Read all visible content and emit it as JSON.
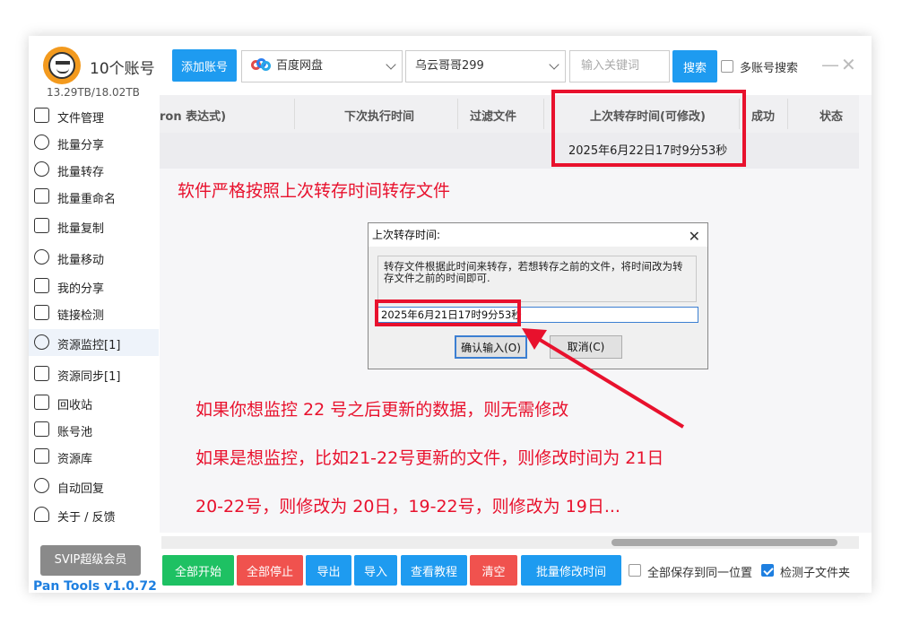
{
  "header": {
    "account_count": "10个账号",
    "storage": "13.29TB/18.02TB",
    "add_account": "添加账号",
    "cloud_select": "百度网盘",
    "account_select": "乌云哥哥299",
    "keyword_placeholder": "输入关键词",
    "search_button": "搜索",
    "multi_search_label": "多账号搜索"
  },
  "sidebar": {
    "items": [
      {
        "label": "文件管理"
      },
      {
        "label": "批量分享"
      },
      {
        "label": "批量转存"
      },
      {
        "label": "批量重命名"
      },
      {
        "label": "批量复制"
      },
      {
        "label": "批量移动"
      },
      {
        "label": "我的分享"
      },
      {
        "label": "链接检测"
      },
      {
        "label": "资源监控[1]"
      },
      {
        "label": "资源同步[1]"
      },
      {
        "label": "回收站"
      },
      {
        "label": "账号池"
      },
      {
        "label": "资源库"
      },
      {
        "label": "自动回复"
      },
      {
        "label": "关于 / 反馈"
      }
    ],
    "svip": "SVIP超级会员",
    "version": "Pan Tools v1.0.72"
  },
  "table": {
    "headers": [
      "ron 表达式)",
      "下次执行时间",
      "过滤文件",
      "上次转存时间(可修改)",
      "成功",
      "状态"
    ],
    "row_time": "2025年6月22日17时9分53秒"
  },
  "annotations": {
    "line1": "软件严格按照上次转存时间转存文件",
    "line2": "如果你想监控 22 号之后更新的数据，则无需修改",
    "line3": "如果是想监控，比如21-22号更新的文件，则修改时间为 21日",
    "line4": "20-22号，则修改为 20日，19-22号，则修改为 19日..."
  },
  "dialog": {
    "title": "上次转存时间:",
    "message": "转存文件根据此时间来转存，若想转存之前的文件，将时间改为转存文件之前的时间即可.",
    "input_value": "2025年6月21日17时9分53秒",
    "confirm": "确认输入(O)",
    "cancel": "取消(C)"
  },
  "bottom": {
    "start_all": "全部开始",
    "stop_all": "全部停止",
    "export": "导出",
    "import": "导入",
    "tutorial": "查看教程",
    "clear": "清空",
    "batch_modify_time": "批量修改时间",
    "save_same_label": "全部保存到同一位置",
    "detect_subfolder_label": "检测子文件夹",
    "detect_subfolder_checked": true
  },
  "colors": {
    "accent": "#1e9bf0",
    "annotation": "#e8112d",
    "green": "#1ec163",
    "red": "#f0524e"
  }
}
